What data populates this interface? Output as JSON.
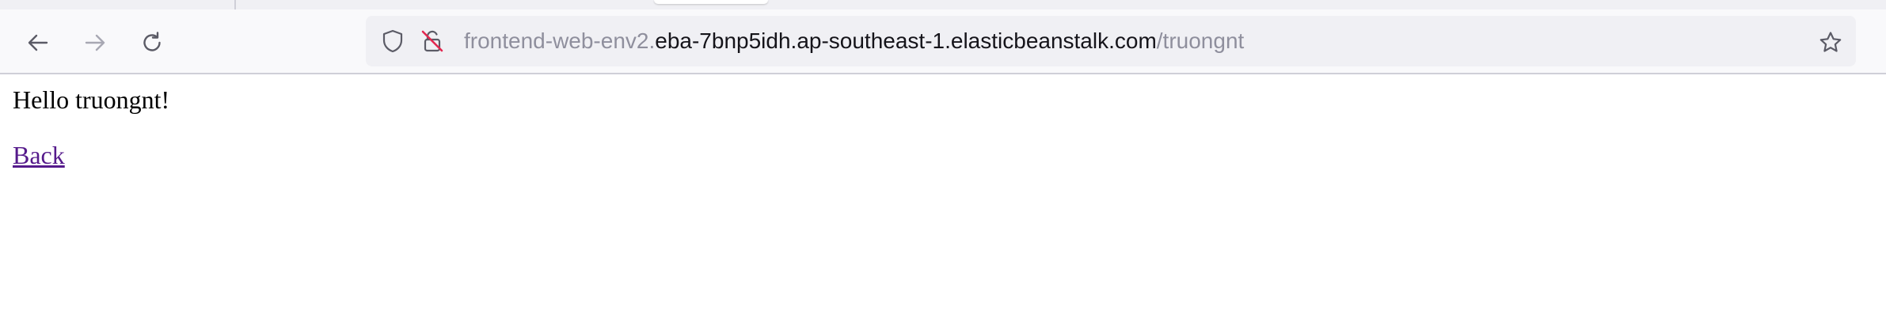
{
  "browser": {
    "icons": {
      "back": "back-arrow-icon",
      "forward": "forward-arrow-icon",
      "reload": "reload-icon",
      "tracking": "shield-icon",
      "insecure": "insecure-lock-icon",
      "bookmark": "star-icon"
    },
    "forward_enabled": false,
    "url": {
      "prefix": "frontend-web-env2.",
      "domain": "eba-7bnp5idh.ap-southeast-1.elasticbeanstalk.com",
      "path": "/truongnt"
    }
  },
  "page": {
    "greeting": "Hello truongnt!",
    "back_link": "Back"
  },
  "colors": {
    "toolbar_bg": "#f9f9fb",
    "urlbar_bg": "#f0f0f4",
    "url_dim": "#8f8f9d",
    "url_text": "#15141a",
    "visited_link": "#551a8b",
    "icon": "#5b5b66",
    "icon_disabled": "#a8a8b3",
    "insecure_slash": "#e22850"
  }
}
